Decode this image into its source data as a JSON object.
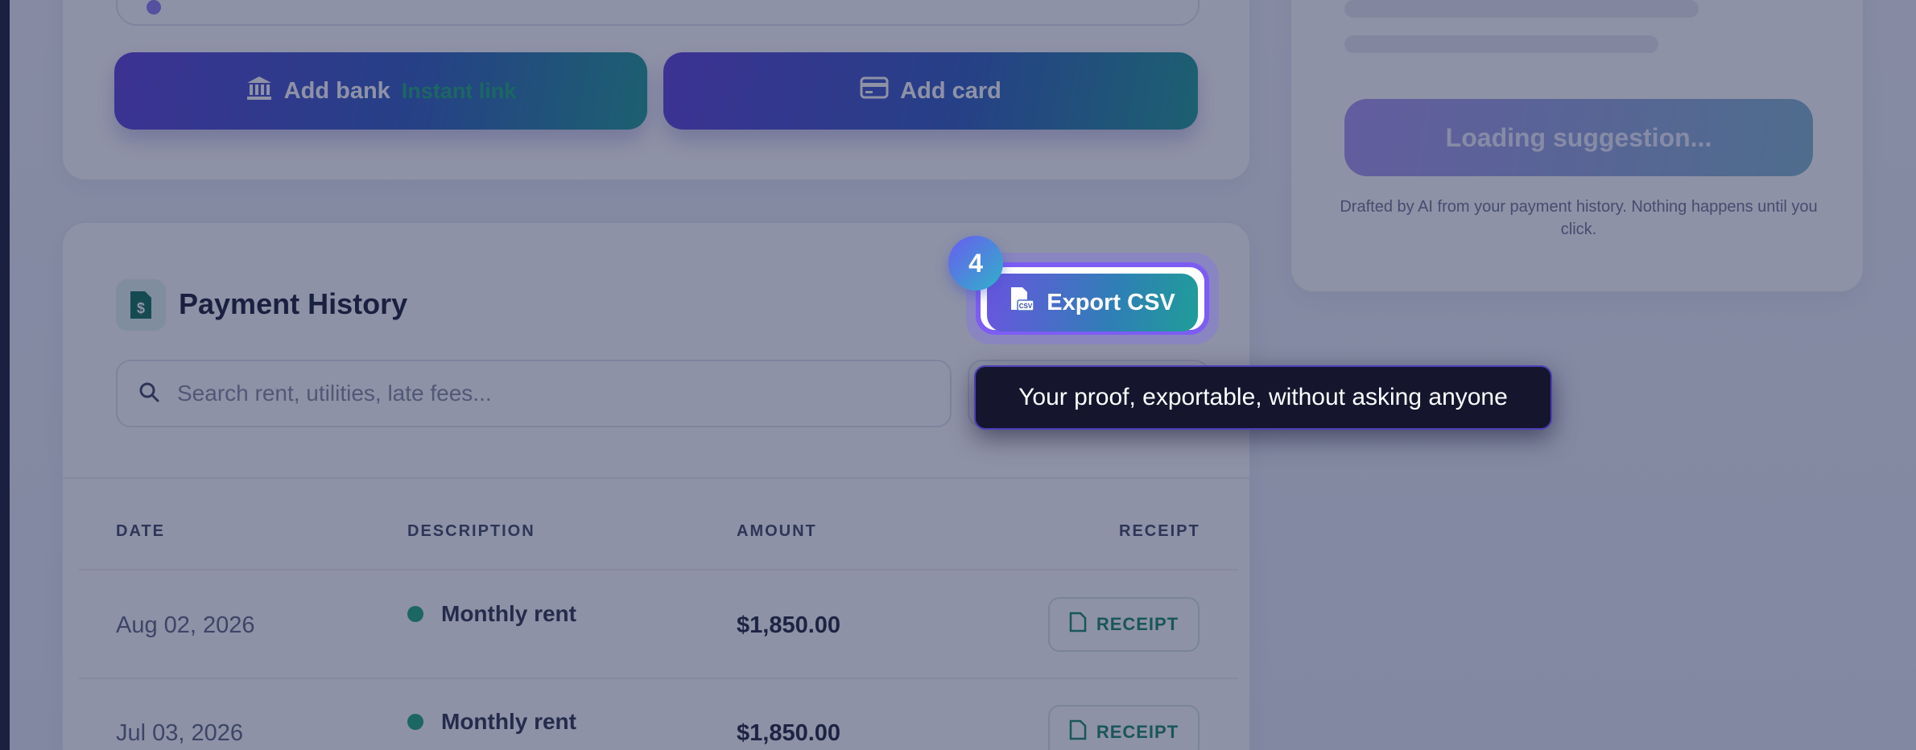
{
  "accounts": {
    "add_bank_label": "Add bank",
    "add_bank_badge": "Instant link",
    "add_card_label": "Add card"
  },
  "history": {
    "title": "Payment History",
    "search_placeholder": "Search rent, utilities, late fees...",
    "export_label": "Export CSV",
    "columns": [
      "DATE",
      "DESCRIPTION",
      "AMOUNT",
      "RECEIPT"
    ],
    "rows": [
      {
        "date": "Aug 02, 2026",
        "description": "Monthly rent",
        "amount": "$1,850.00",
        "receipt": "RECEIPT"
      },
      {
        "date": "Jul 03, 2026",
        "description": "Monthly rent",
        "amount": "$1,850.00",
        "receipt": "RECEIPT"
      }
    ]
  },
  "suggestion": {
    "button_label": "Loading suggestion...",
    "note": "Drafted by AI from your payment history. Nothing happens until you click."
  },
  "tour": {
    "step_number": "4",
    "tooltip": "Your proof, exportable, without asking anyone"
  },
  "icons": [
    "bank-icon",
    "card-icon",
    "invoice-dollar-icon",
    "search-icon",
    "csv-file-icon",
    "receipt-icon"
  ],
  "colors": {
    "accent_purple": "#5a3fd7",
    "accent_teal": "#1b9a93",
    "success_green": "#1aa67a",
    "overlay": "#1e264e"
  }
}
